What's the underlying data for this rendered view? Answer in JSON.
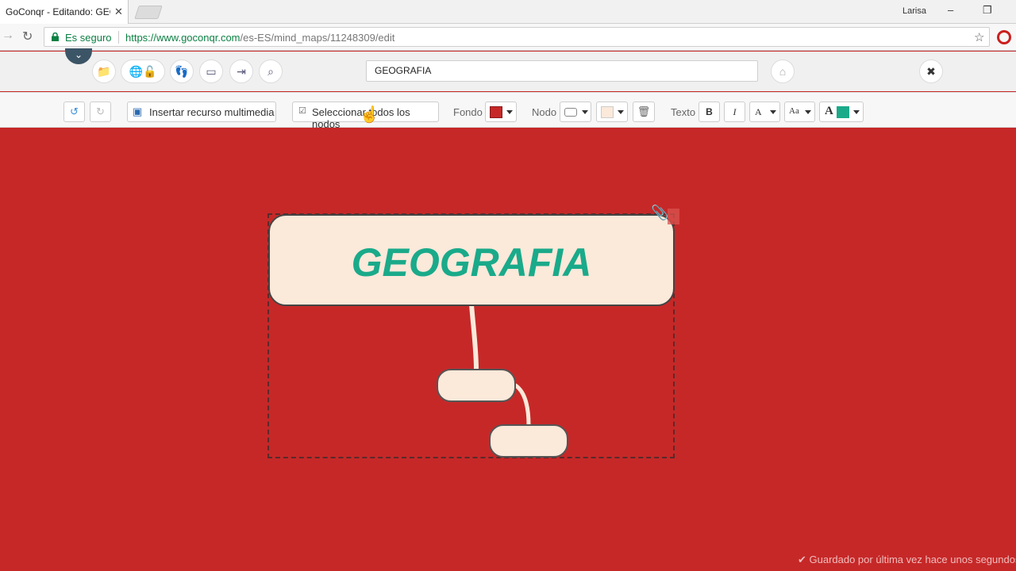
{
  "browser": {
    "tab_title": "GoConqr - Editando: GEO",
    "tab_close": "✕",
    "profile_name": "Larisa",
    "window_minimize": "–",
    "window_restore": "❐",
    "secure_label": "Es seguro",
    "url_host": "https://www.goconqr.com",
    "url_path": "/es-ES/mind_maps/11248309/edit"
  },
  "toolbar_top": {
    "title_value": "GEOGRAFIA",
    "icons": [
      "folder-icon",
      "globe-icon",
      "lock-icon",
      "footprint-icon",
      "image-icon",
      "import-icon",
      "zoom-icon"
    ],
    "tag_icon": "tag-icon",
    "close_label": "✖"
  },
  "toolbar_format": {
    "insert_media": "Insertar recurso multimedia",
    "select_all_nodes": "Seleccionar todos los nodos",
    "fondo_label": "Fondo",
    "nodo_label": "Nodo",
    "texto_label": "Texto",
    "bold_label": "B",
    "italic_label": "I",
    "size_label": "A",
    "case_label": "Aa",
    "color_label": "A",
    "background_color": "#c62828",
    "node_fill_color": "#fbe9da",
    "text_color": "#1aaa8a"
  },
  "mindmap": {
    "root_label": "GEOGRAFIA",
    "child_1_label": "",
    "child_2_label": ""
  },
  "status": {
    "saved_text": "✔ Guardado por última vez hace unos segundos"
  }
}
